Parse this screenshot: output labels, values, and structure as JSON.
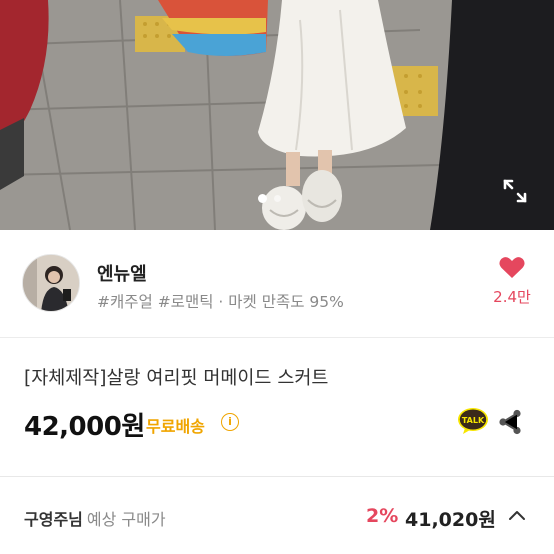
{
  "hero": {
    "page_count": 2,
    "active_page": 1
  },
  "seller": {
    "name": "엔뉴엘",
    "tags": "#캐주얼 #로맨틱 · 마켓 만족도 95%",
    "likes": "2.4만"
  },
  "product": {
    "title": "[자체제작]살랑 여리핏 머메이드 스커트",
    "price": "42,000원",
    "shipping": "무료배송",
    "talk_label": "TALK"
  },
  "expected": {
    "buyer": "구영주님",
    "label": "예상 구매가",
    "discount": "2%",
    "price": "41,020원"
  },
  "colors": {
    "accent_pink": "#e5475e",
    "shipping_yellow": "#f0a500",
    "talk_yellow": "#f7e600"
  },
  "icons": [
    "expand-icon",
    "heart-icon",
    "info-icon",
    "kakao-talk-icon",
    "share-icon",
    "chevron-up-icon"
  ]
}
